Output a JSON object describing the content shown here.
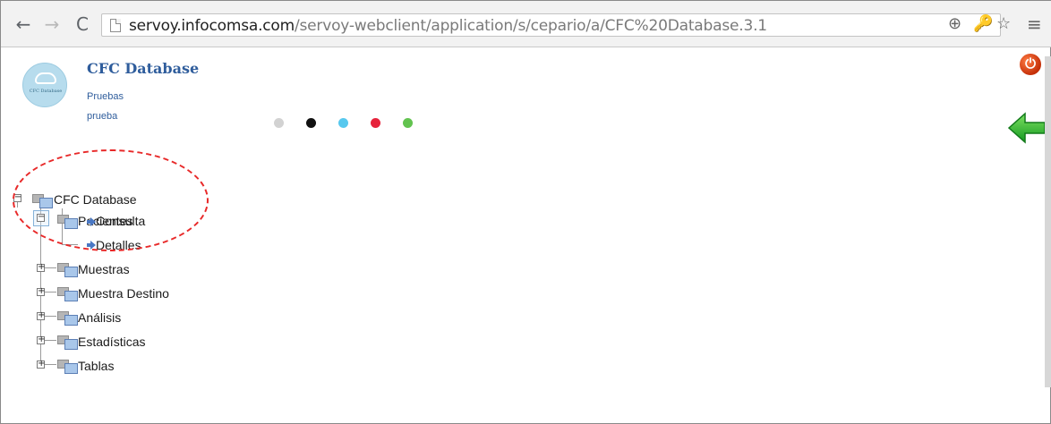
{
  "browser": {
    "address_host": "servoy.infocomsa.com",
    "address_path": "/servoy-webclient/application/s/cepario/a/CFC%20Database.3.1",
    "icons": [
      "back-arrow-icon",
      "forward-arrow-icon",
      "reload-icon",
      "page-icon",
      "zoom-icon",
      "key-icon",
      "star-icon",
      "menu-icon"
    ]
  },
  "header": {
    "title": "CFC Database",
    "subtitle_1": "Pruebas",
    "subtitle_2": "prueba",
    "logo_text": "CFC Database"
  },
  "theme_dots": [
    {
      "name": "gray",
      "color": "#d2d2d2"
    },
    {
      "name": "black",
      "color": "#111111"
    },
    {
      "name": "light-blue",
      "color": "#57c8ee"
    },
    {
      "name": "red",
      "color": "#e6233b"
    },
    {
      "name": "green",
      "color": "#62c34f"
    }
  ],
  "tree": {
    "root": "CFC Database",
    "pacientes": "Pacientes",
    "consulta": "Consulta",
    "detalles": "Detalles",
    "muestras": "Muestras",
    "muestra_destino": "Muestra Destino",
    "analisis": "Análisis",
    "estadisticas": "Estadísticas",
    "tablas": "Tablas"
  },
  "colors": {
    "title_blue": "#2f5d9c",
    "annotation_red": "#e82929"
  }
}
